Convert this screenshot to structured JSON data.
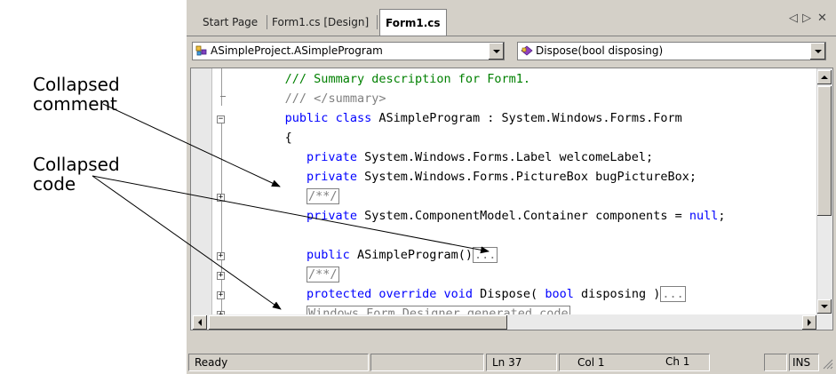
{
  "callouts": {
    "collapsed_comment": [
      "Collapsed",
      "comment"
    ],
    "collapsed_code": [
      "Collapsed",
      "code"
    ]
  },
  "tabs": [
    {
      "label": "Start Page",
      "active": false
    },
    {
      "label": "Form1.cs [Design]",
      "active": false
    },
    {
      "label": "Form1.cs",
      "active": true
    }
  ],
  "tab_controls": {
    "prev": "◁",
    "next": "▷",
    "close": "✕"
  },
  "class_combo": {
    "value": "ASimpleProject.ASimpleProgram",
    "icon": "class-icon"
  },
  "member_combo": {
    "value": "Dispose(bool disposing)",
    "icon": "method-icon"
  },
  "code_lines": [
    {
      "indent": "   ",
      "parts": [
        {
          "t": "/// Summary description for Form1.",
          "c": "cm"
        }
      ]
    },
    {
      "indent": "   ",
      "parts": [
        {
          "t": "/// </summary>",
          "c": "cg"
        }
      ]
    },
    {
      "indent": "   ",
      "parts": [
        {
          "t": "public",
          "c": "kw"
        },
        {
          "t": " ",
          "c": "text"
        },
        {
          "t": "class",
          "c": "kw"
        },
        {
          "t": " ASimpleProgram : System.Windows.Forms.Form",
          "c": "text"
        }
      ]
    },
    {
      "indent": "   ",
      "parts": [
        {
          "t": "{",
          "c": "text"
        }
      ]
    },
    {
      "indent": "      ",
      "parts": [
        {
          "t": "private",
          "c": "kw"
        },
        {
          "t": " System.Windows.Forms.Label welcomeLabel;",
          "c": "text"
        }
      ]
    },
    {
      "indent": "      ",
      "parts": [
        {
          "t": "private",
          "c": "kw"
        },
        {
          "t": " System.Windows.Forms.PictureBox bugPictureBox;",
          "c": "text"
        }
      ]
    },
    {
      "indent": "      ",
      "parts": [
        {
          "t": "/**/",
          "c": "box"
        }
      ]
    },
    {
      "indent": "      ",
      "parts": [
        {
          "t": "private",
          "c": "kw"
        },
        {
          "t": " System.ComponentModel.Container components = ",
          "c": "text"
        },
        {
          "t": "null",
          "c": "kw"
        },
        {
          "t": ";",
          "c": "text"
        }
      ]
    },
    {
      "indent": "",
      "parts": []
    },
    {
      "indent": "      ",
      "parts": [
        {
          "t": "public",
          "c": "kw"
        },
        {
          "t": " ASimpleProgram()",
          "c": "text"
        },
        {
          "t": "...",
          "c": "box"
        }
      ]
    },
    {
      "indent": "      ",
      "parts": [
        {
          "t": "/**/",
          "c": "box"
        }
      ]
    },
    {
      "indent": "      ",
      "parts": [
        {
          "t": "protected",
          "c": "kw"
        },
        {
          "t": " ",
          "c": "text"
        },
        {
          "t": "override",
          "c": "kw"
        },
        {
          "t": " ",
          "c": "text"
        },
        {
          "t": "void",
          "c": "kw"
        },
        {
          "t": " Dispose( ",
          "c": "text"
        },
        {
          "t": "bool",
          "c": "kw"
        },
        {
          "t": " disposing )",
          "c": "text"
        },
        {
          "t": "...",
          "c": "box"
        }
      ]
    },
    {
      "indent": "      ",
      "parts": [
        {
          "t": "Windows Form Designer generated code",
          "c": "box"
        }
      ]
    }
  ],
  "status": {
    "text": "Ready",
    "ln": "Ln 37",
    "col": "Col 1",
    "ch": "Ch 1",
    "mode": "INS"
  },
  "colors": {
    "keyword": "#0000ff",
    "comment": "#008000",
    "collapsed": "#808080",
    "chrome": "#d4d0c8"
  }
}
